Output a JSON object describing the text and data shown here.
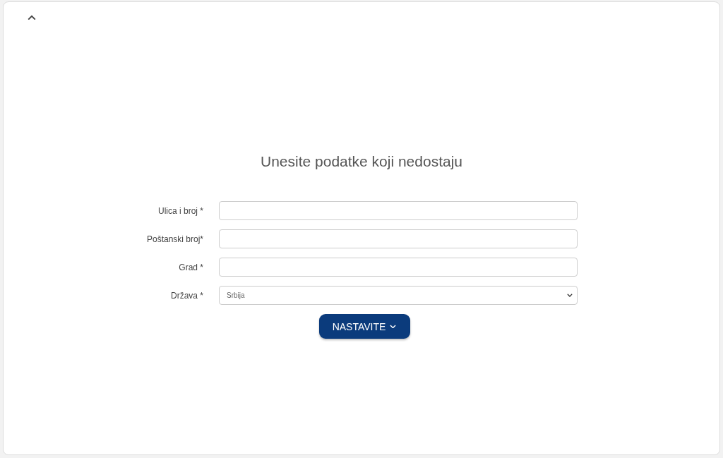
{
  "title": "Unesite podatke koji nedostaju",
  "fields": [
    {
      "label": "Ulica i broj *",
      "kind": "text"
    },
    {
      "label": "Poštanski broj*",
      "kind": "text"
    },
    {
      "label": "Grad *",
      "kind": "text"
    },
    {
      "label": "Država *",
      "kind": "select",
      "value": "Srbija"
    }
  ],
  "submit": {
    "label": "NASTAVITE"
  }
}
